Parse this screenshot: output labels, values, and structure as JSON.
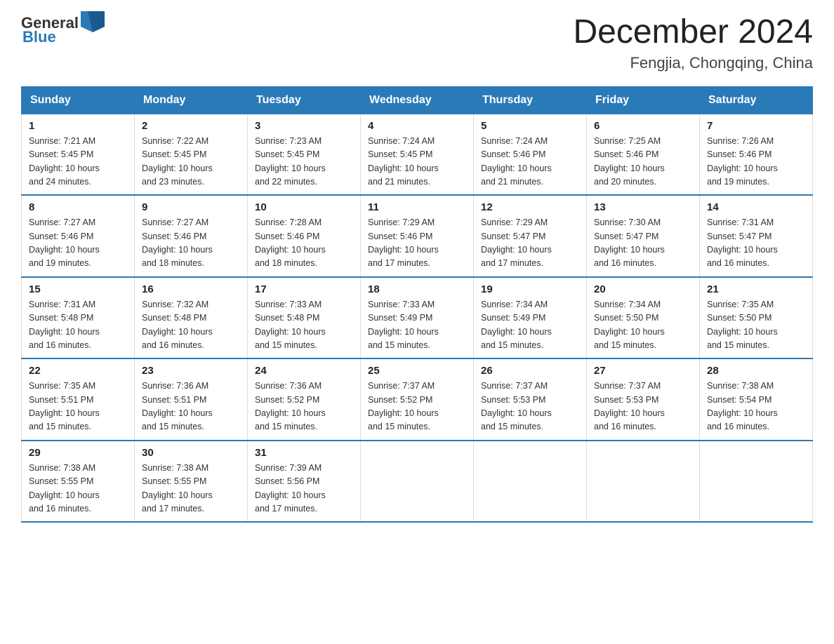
{
  "logo": {
    "text_general": "General",
    "text_blue": "Blue",
    "icon_label": "general-blue-logo"
  },
  "header": {
    "title": "December 2024",
    "subtitle": "Fengjia, Chongqing, China"
  },
  "weekdays": [
    "Sunday",
    "Monday",
    "Tuesday",
    "Wednesday",
    "Thursday",
    "Friday",
    "Saturday"
  ],
  "weeks": [
    [
      {
        "day": "1",
        "sunrise": "7:21 AM",
        "sunset": "5:45 PM",
        "daylight": "10 hours and 24 minutes."
      },
      {
        "day": "2",
        "sunrise": "7:22 AM",
        "sunset": "5:45 PM",
        "daylight": "10 hours and 23 minutes."
      },
      {
        "day": "3",
        "sunrise": "7:23 AM",
        "sunset": "5:45 PM",
        "daylight": "10 hours and 22 minutes."
      },
      {
        "day": "4",
        "sunrise": "7:24 AM",
        "sunset": "5:45 PM",
        "daylight": "10 hours and 21 minutes."
      },
      {
        "day": "5",
        "sunrise": "7:24 AM",
        "sunset": "5:46 PM",
        "daylight": "10 hours and 21 minutes."
      },
      {
        "day": "6",
        "sunrise": "7:25 AM",
        "sunset": "5:46 PM",
        "daylight": "10 hours and 20 minutes."
      },
      {
        "day": "7",
        "sunrise": "7:26 AM",
        "sunset": "5:46 PM",
        "daylight": "10 hours and 19 minutes."
      }
    ],
    [
      {
        "day": "8",
        "sunrise": "7:27 AM",
        "sunset": "5:46 PM",
        "daylight": "10 hours and 19 minutes."
      },
      {
        "day": "9",
        "sunrise": "7:27 AM",
        "sunset": "5:46 PM",
        "daylight": "10 hours and 18 minutes."
      },
      {
        "day": "10",
        "sunrise": "7:28 AM",
        "sunset": "5:46 PM",
        "daylight": "10 hours and 18 minutes."
      },
      {
        "day": "11",
        "sunrise": "7:29 AM",
        "sunset": "5:46 PM",
        "daylight": "10 hours and 17 minutes."
      },
      {
        "day": "12",
        "sunrise": "7:29 AM",
        "sunset": "5:47 PM",
        "daylight": "10 hours and 17 minutes."
      },
      {
        "day": "13",
        "sunrise": "7:30 AM",
        "sunset": "5:47 PM",
        "daylight": "10 hours and 16 minutes."
      },
      {
        "day": "14",
        "sunrise": "7:31 AM",
        "sunset": "5:47 PM",
        "daylight": "10 hours and 16 minutes."
      }
    ],
    [
      {
        "day": "15",
        "sunrise": "7:31 AM",
        "sunset": "5:48 PM",
        "daylight": "10 hours and 16 minutes."
      },
      {
        "day": "16",
        "sunrise": "7:32 AM",
        "sunset": "5:48 PM",
        "daylight": "10 hours and 16 minutes."
      },
      {
        "day": "17",
        "sunrise": "7:33 AM",
        "sunset": "5:48 PM",
        "daylight": "10 hours and 15 minutes."
      },
      {
        "day": "18",
        "sunrise": "7:33 AM",
        "sunset": "5:49 PM",
        "daylight": "10 hours and 15 minutes."
      },
      {
        "day": "19",
        "sunrise": "7:34 AM",
        "sunset": "5:49 PM",
        "daylight": "10 hours and 15 minutes."
      },
      {
        "day": "20",
        "sunrise": "7:34 AM",
        "sunset": "5:50 PM",
        "daylight": "10 hours and 15 minutes."
      },
      {
        "day": "21",
        "sunrise": "7:35 AM",
        "sunset": "5:50 PM",
        "daylight": "10 hours and 15 minutes."
      }
    ],
    [
      {
        "day": "22",
        "sunrise": "7:35 AM",
        "sunset": "5:51 PM",
        "daylight": "10 hours and 15 minutes."
      },
      {
        "day": "23",
        "sunrise": "7:36 AM",
        "sunset": "5:51 PM",
        "daylight": "10 hours and 15 minutes."
      },
      {
        "day": "24",
        "sunrise": "7:36 AM",
        "sunset": "5:52 PM",
        "daylight": "10 hours and 15 minutes."
      },
      {
        "day": "25",
        "sunrise": "7:37 AM",
        "sunset": "5:52 PM",
        "daylight": "10 hours and 15 minutes."
      },
      {
        "day": "26",
        "sunrise": "7:37 AM",
        "sunset": "5:53 PM",
        "daylight": "10 hours and 15 minutes."
      },
      {
        "day": "27",
        "sunrise": "7:37 AM",
        "sunset": "5:53 PM",
        "daylight": "10 hours and 16 minutes."
      },
      {
        "day": "28",
        "sunrise": "7:38 AM",
        "sunset": "5:54 PM",
        "daylight": "10 hours and 16 minutes."
      }
    ],
    [
      {
        "day": "29",
        "sunrise": "7:38 AM",
        "sunset": "5:55 PM",
        "daylight": "10 hours and 16 minutes."
      },
      {
        "day": "30",
        "sunrise": "7:38 AM",
        "sunset": "5:55 PM",
        "daylight": "10 hours and 17 minutes."
      },
      {
        "day": "31",
        "sunrise": "7:39 AM",
        "sunset": "5:56 PM",
        "daylight": "10 hours and 17 minutes."
      },
      null,
      null,
      null,
      null
    ]
  ],
  "labels": {
    "sunrise": "Sunrise:",
    "sunset": "Sunset:",
    "daylight": "Daylight:"
  }
}
